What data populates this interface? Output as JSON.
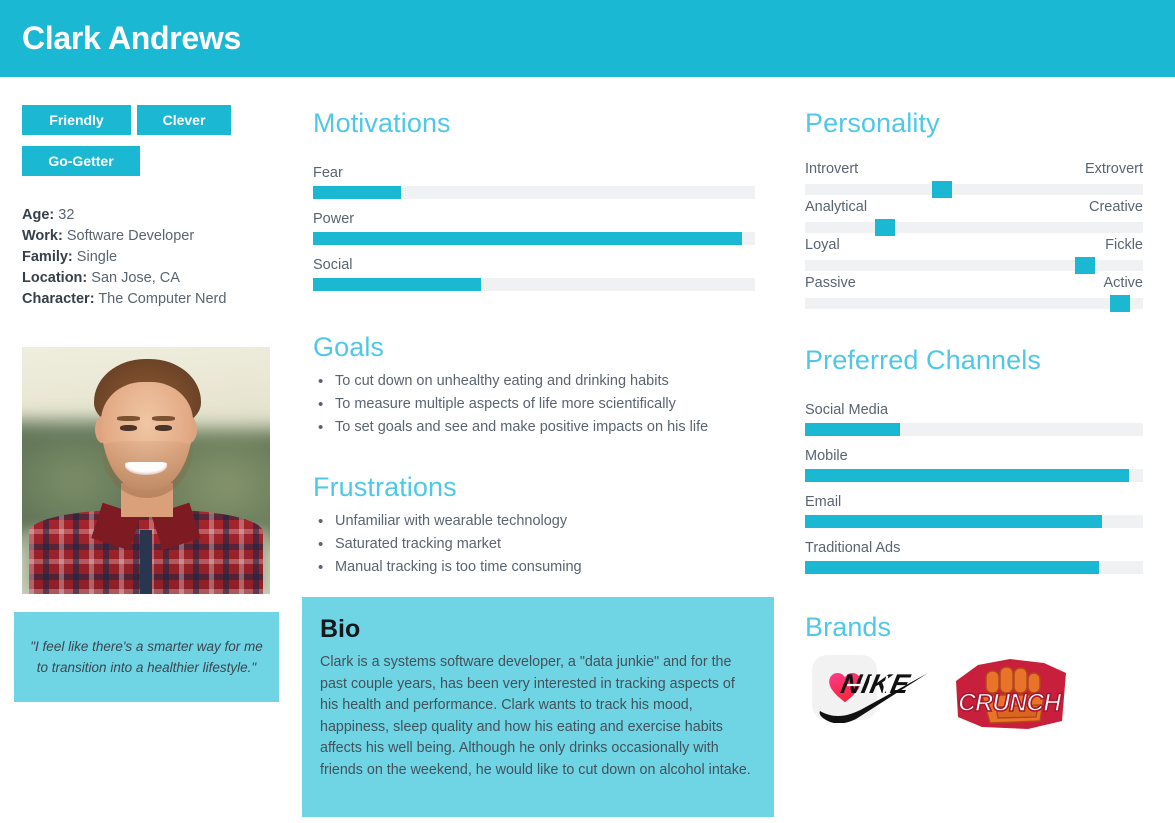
{
  "header": {
    "title": "Clark Andrews"
  },
  "tags": [
    {
      "label": "Friendly"
    },
    {
      "label": "Clever"
    },
    {
      "label": "Go-Getter"
    }
  ],
  "demographics": [
    {
      "key": "Age:",
      "value": "32"
    },
    {
      "key": "Work:",
      "value": "Software Developer"
    },
    {
      "key": "Family:",
      "value": "Single"
    },
    {
      "key": "Location:",
      "value": "San Jose, CA"
    },
    {
      "key": "Character:",
      "value": "The Computer Nerd"
    }
  ],
  "quote": {
    "text": "\"I feel like there's a smarter way for me to transition into a healthier lifestyle.\""
  },
  "sections": {
    "motivations": "Motivations",
    "goals": "Goals",
    "frustrations": "Frustrations",
    "personality": "Personality",
    "channels": "Preferred Channels",
    "brands": "Brands",
    "bio": "Bio"
  },
  "goals": [
    "To cut down on unhealthy eating and drinking habits",
    "To measure multiple aspects of life more scientifically",
    "To set goals and see and make positive impacts on his life"
  ],
  "frustrations": [
    "Unfamiliar with wearable technology",
    "Saturated tracking market",
    "Manual tracking is too time consuming"
  ],
  "bio": {
    "title": "Bio",
    "text": "Clark is a systems software developer, a \"data junkie\" and for the past couple years, has been very interested in tracking aspects of his health and performance. Clark wants to track his mood, happiness, sleep quality and how his eating and exercise habits affects his well being. Although he only drinks occasionally with friends on the weekend, he would like to cut down on alcohol intake."
  },
  "brands": [
    {
      "name": "nike-logo",
      "label": "NIKE"
    },
    {
      "name": "crunch-logo",
      "label": "CRUNCH"
    },
    {
      "name": "apple-health-logo",
      "label": "Health"
    }
  ],
  "colors": {
    "brand_teal": "#1BB8D4",
    "light_teal": "#6FD4E4",
    "heading_blue": "#4FC8E8",
    "track_gray": "#F0F1F2",
    "body_text": "#5A6470"
  },
  "chart_data": [
    {
      "type": "bar",
      "title": "Motivations",
      "categories": [
        "Fear",
        "Power",
        "Social"
      ],
      "values": [
        20,
        97,
        38
      ],
      "xlabel": "",
      "ylabel": "",
      "ylim": [
        0,
        100
      ],
      "orientation": "horizontal",
      "grid": false,
      "legend": "none"
    },
    {
      "type": "bar",
      "title": "Personality",
      "categories": [
        "Introvert–Extrovert",
        "Analytical–Creative",
        "Loyal–Fickle",
        "Passive–Active"
      ],
      "values": [
        40,
        22,
        85,
        96
      ],
      "left_labels": [
        "Introvert",
        "Analytical",
        "Loyal",
        "Passive"
      ],
      "right_labels": [
        "Extrovert",
        "Creative",
        "Fickle",
        "Active"
      ],
      "xlabel": "",
      "ylabel": "",
      "ylim": [
        0,
        100
      ],
      "orientation": "horizontal",
      "marker": "slider-thumb",
      "grid": false,
      "legend": "none"
    },
    {
      "type": "bar",
      "title": "Preferred Channels",
      "categories": [
        "Social Media",
        "Mobile",
        "Email",
        "Traditional Ads"
      ],
      "values": [
        28,
        96,
        88,
        87
      ],
      "xlabel": "",
      "ylabel": "",
      "ylim": [
        0,
        100
      ],
      "orientation": "horizontal",
      "grid": false,
      "legend": "none"
    }
  ]
}
